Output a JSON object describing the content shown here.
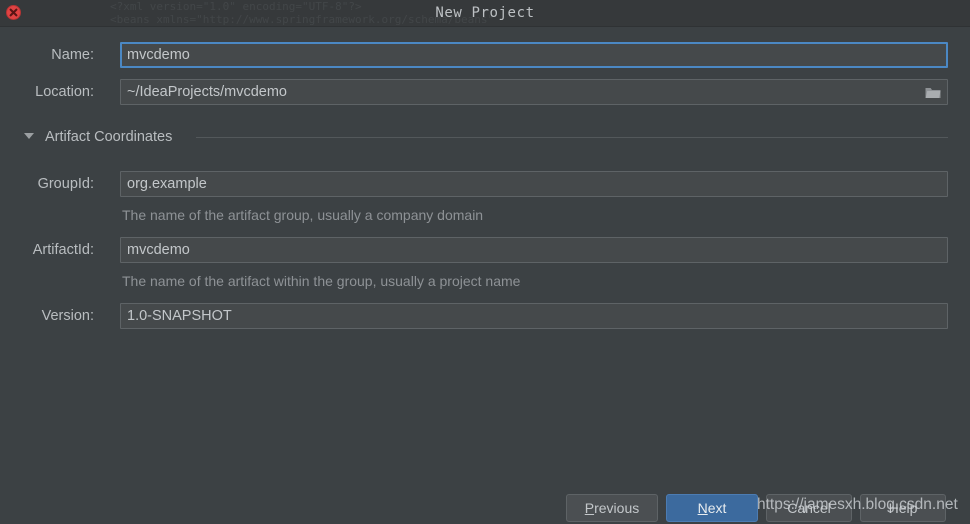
{
  "window": {
    "title": "New Project",
    "close_icon": "close-icon",
    "ghost_text_line1": "<?xml version=\"1.0\" encoding=\"UTF-8\"?>",
    "ghost_text_line2": "<beans xmlns=\"http://www.springframework.org/schema/beans\""
  },
  "form": {
    "name": {
      "label": "Name:",
      "value": "mvcdemo",
      "focused": true
    },
    "location": {
      "label": "Location:",
      "value": "~/IdeaProjects/mvcdemo",
      "browse_icon": "folder-icon"
    },
    "section": {
      "title": "Artifact Coordinates",
      "expanded": true,
      "arrow_icon": "chevron-down-icon"
    },
    "group_id": {
      "label": "GroupId:",
      "value": "org.example",
      "hint": "The name of the artifact group, usually a company domain"
    },
    "artifact_id": {
      "label": "ArtifactId:",
      "value": "mvcdemo",
      "hint": "The name of the artifact within the group, usually a project name"
    },
    "version": {
      "label": "Version:",
      "value": "1.0-SNAPSHOT"
    }
  },
  "footer": {
    "previous": {
      "label": "Previous",
      "mnemonic": "P"
    },
    "next": {
      "label": "Next",
      "mnemonic": "N",
      "primary": true
    },
    "cancel": {
      "label": "Cancel"
    },
    "help": {
      "label": "Help"
    }
  },
  "watermark": {
    "text": "https://jamesxh.blog.csdn.net"
  },
  "colors": {
    "background": "#3c4144",
    "titlebar": "#36393b",
    "field_bg": "#45494b",
    "field_border": "#5e6366",
    "focus_border": "#4b88c4",
    "accent_button": "#3c6a9e",
    "text": "#b9bdc0",
    "hint_text": "#8e9296",
    "close_button": "#e04343"
  }
}
